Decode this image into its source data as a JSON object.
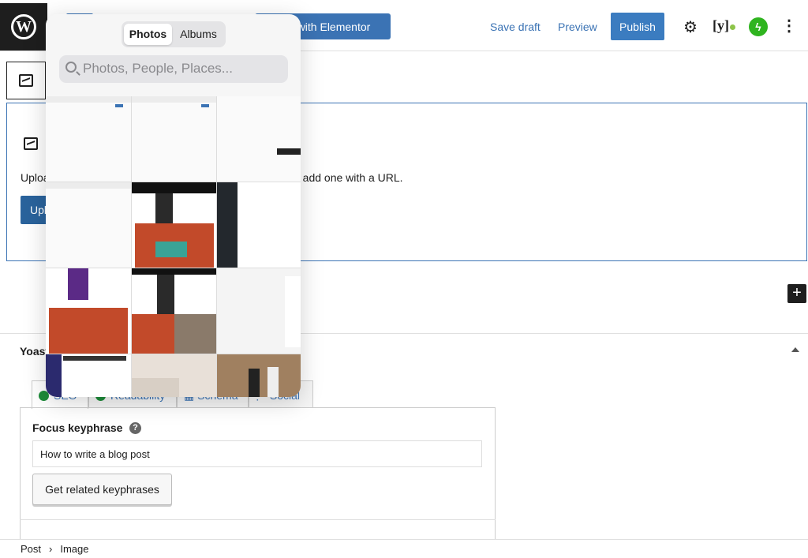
{
  "header": {
    "edit_elementor": "Edit with Elementor",
    "save_draft": "Save draft",
    "preview": "Preview",
    "publish": "Publish",
    "icons": [
      "wordpress-logo",
      "settings-gear-icon",
      "yoast-icon",
      "jetpack-icon",
      "more-vertical-icon"
    ]
  },
  "image_block": {
    "instructions": "Upload an image file, pick one from your media library, or add one with a URL.",
    "upload_label": "Upload"
  },
  "yoast": {
    "title": "Yoast SEO",
    "tabs": [
      "SEO",
      "Readability",
      "Schema",
      "Social"
    ],
    "focus_label": "Focus keyphrase",
    "focus_value": "How to write a blog post",
    "related_button": "Get related keyphrases"
  },
  "breadcrumb": [
    "Post",
    "Image"
  ],
  "photos_popup": {
    "segments": [
      "Photos",
      "Albums"
    ],
    "selected_segment": "Photos",
    "search_placeholder": "Photos, People, Places..."
  },
  "colors": {
    "accent": "#3b73b4",
    "publish": "#3b7cc0",
    "seo_good": "#1e8c3a"
  }
}
